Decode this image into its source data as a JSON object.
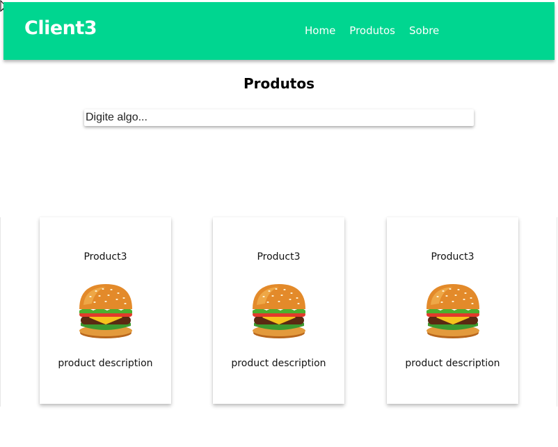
{
  "navbar": {
    "brand": "Client3",
    "links": [
      "Home",
      "Produtos",
      "Sobre"
    ],
    "background": "#00d690"
  },
  "page": {
    "title": "Produtos"
  },
  "search": {
    "placeholder": "Digite algo..."
  },
  "products": [
    {
      "name": "Product3",
      "description": "product description",
      "icon": "burger-icon"
    },
    {
      "name": "Product3",
      "description": "product description",
      "icon": "burger-icon"
    },
    {
      "name": "Product3",
      "description": "product description",
      "icon": "burger-icon"
    }
  ]
}
